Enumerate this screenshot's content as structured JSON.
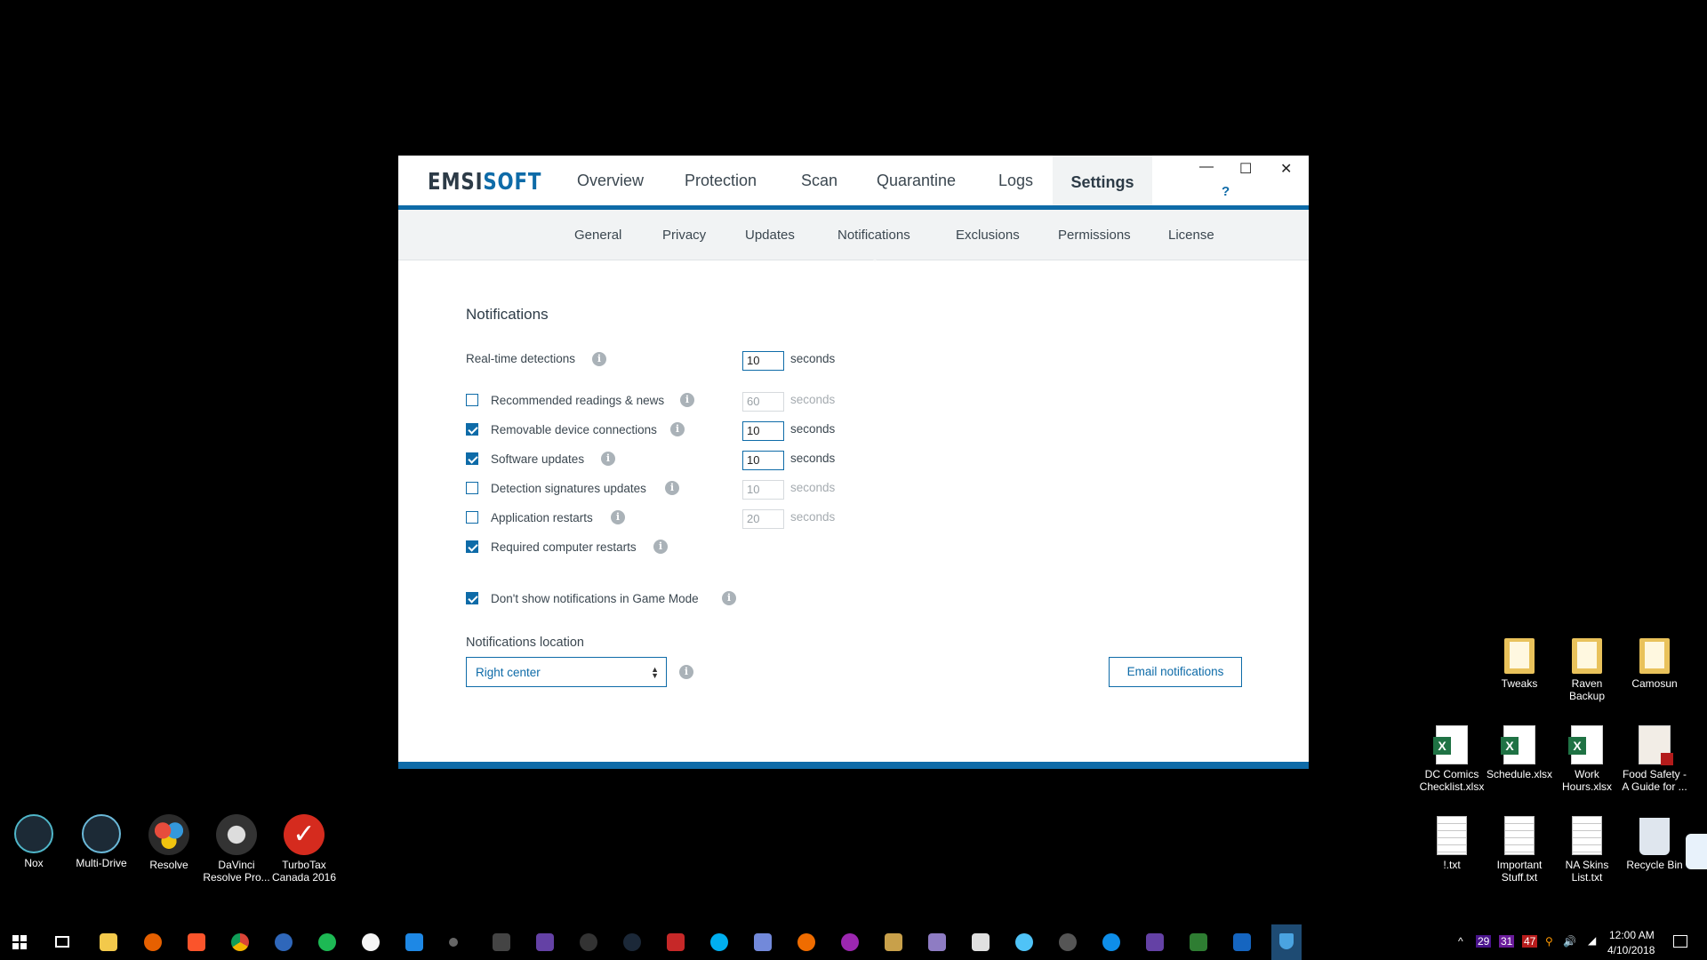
{
  "window": {
    "logo_a": "EMSI",
    "logo_b": "SOFT",
    "nav": [
      "Overview",
      "Protection",
      "Scan",
      "Quarantine",
      "Logs"
    ],
    "active_tab": "Settings",
    "help": "?",
    "controls": {
      "minimize": "—",
      "maximize": "☐",
      "close": "✕"
    },
    "subnav": [
      "General",
      "Privacy",
      "Updates",
      "Notifications",
      "Exclusions",
      "Permissions",
      "License"
    ]
  },
  "notifications": {
    "heading": "Notifications",
    "realtime": {
      "label": "Real-time detections",
      "value": "10",
      "unit": "seconds"
    },
    "items": [
      {
        "label": "Recommended readings & news",
        "checked": false,
        "value": "60",
        "unit": "seconds"
      },
      {
        "label": "Removable device connections",
        "checked": true,
        "value": "10",
        "unit": "seconds"
      },
      {
        "label": "Software updates",
        "checked": true,
        "value": "10",
        "unit": "seconds"
      },
      {
        "label": "Detection signatures updates",
        "checked": false,
        "value": "10",
        "unit": "seconds"
      },
      {
        "label": "Application restarts",
        "checked": false,
        "value": "20",
        "unit": "seconds"
      },
      {
        "label": "Required computer restarts",
        "checked": true
      }
    ],
    "game_mode": {
      "label": "Don't show notifications in Game Mode",
      "checked": true
    },
    "location_label": "Notifications location",
    "location_value": "Right center",
    "email_button": "Email notifications"
  },
  "desktop": {
    "left": [
      {
        "name": "Nox"
      },
      {
        "name": "Multi-Drive"
      },
      {
        "name": "Resolve"
      },
      {
        "name": "DaVinci Resolve Pro..."
      },
      {
        "name": "TurboTax Canada 2016"
      }
    ],
    "right": [
      {
        "name": "Tweaks",
        "kind": "folder"
      },
      {
        "name": "Raven Backup",
        "kind": "folder"
      },
      {
        "name": "Camosun",
        "kind": "folder"
      },
      {
        "name": "DC Comics Checklist.xlsx",
        "kind": "xls"
      },
      {
        "name": "Schedule.xlsx",
        "kind": "xls"
      },
      {
        "name": "Work Hours.xlsx",
        "kind": "xls"
      },
      {
        "name": "Food Safety - A Guide for ...",
        "kind": "pdf"
      },
      {
        "name": "!.txt",
        "kind": "txt"
      },
      {
        "name": "Important Stuff.txt",
        "kind": "txt"
      },
      {
        "name": "NA Skins List.txt",
        "kind": "txt"
      },
      {
        "name": "Recycle Bin",
        "kind": "bin"
      }
    ]
  },
  "taskbar": {
    "badges": [
      "29",
      "31",
      "47"
    ],
    "time": "12:00 AM",
    "date": "4/10/2018"
  }
}
